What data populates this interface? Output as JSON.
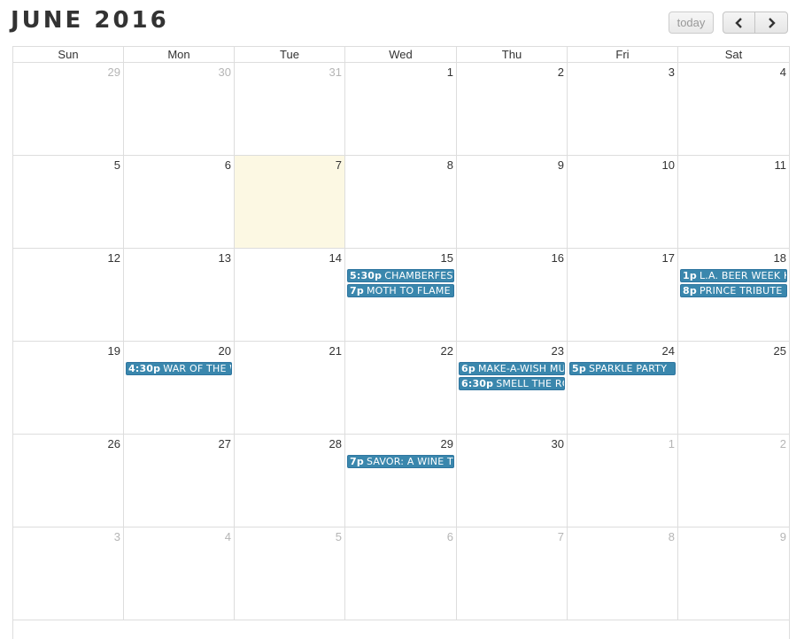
{
  "header": {
    "title": "JUNE 2016",
    "today_label": "today",
    "prev_icon": "chevron-left-icon",
    "next_icon": "chevron-right-icon"
  },
  "weekdays": [
    "Sun",
    "Mon",
    "Tue",
    "Wed",
    "Thu",
    "Fri",
    "Sat"
  ],
  "weeks": [
    {
      "days": [
        {
          "num": "29",
          "other": true
        },
        {
          "num": "30",
          "other": true
        },
        {
          "num": "31",
          "other": true
        },
        {
          "num": "1"
        },
        {
          "num": "2"
        },
        {
          "num": "3"
        },
        {
          "num": "4"
        }
      ]
    },
    {
      "days": [
        {
          "num": "5"
        },
        {
          "num": "6"
        },
        {
          "num": "7",
          "today": true
        },
        {
          "num": "8"
        },
        {
          "num": "9"
        },
        {
          "num": "10"
        },
        {
          "num": "11"
        }
      ]
    },
    {
      "days": [
        {
          "num": "12"
        },
        {
          "num": "13"
        },
        {
          "num": "14"
        },
        {
          "num": "15",
          "events": [
            {
              "time": "5:30p",
              "title": "CHAMBERFEST"
            },
            {
              "time": "7p",
              "title": "MOTH TO FLAME"
            }
          ]
        },
        {
          "num": "16"
        },
        {
          "num": "17"
        },
        {
          "num": "18",
          "events": [
            {
              "time": "1p",
              "title": "L.A. BEER WEEK K"
            },
            {
              "time": "8p",
              "title": "PRINCE TRIBUTE"
            }
          ]
        }
      ]
    },
    {
      "days": [
        {
          "num": "19"
        },
        {
          "num": "20",
          "events": [
            {
              "time": "4:30p",
              "title": "WAR OF THE W"
            }
          ]
        },
        {
          "num": "21"
        },
        {
          "num": "22"
        },
        {
          "num": "23",
          "events": [
            {
              "time": "6p",
              "title": "MAKE-A-WISH MU"
            },
            {
              "time": "6:30p",
              "title": "SMELL THE RO"
            }
          ]
        },
        {
          "num": "24",
          "events": [
            {
              "time": "5p",
              "title": "SPARKLE PARTY"
            }
          ]
        },
        {
          "num": "25"
        }
      ]
    },
    {
      "days": [
        {
          "num": "26"
        },
        {
          "num": "27"
        },
        {
          "num": "28"
        },
        {
          "num": "29",
          "events": [
            {
              "time": "7p",
              "title": "SAVOR: A WINE T"
            }
          ]
        },
        {
          "num": "30"
        },
        {
          "num": "1",
          "other": true
        },
        {
          "num": "2",
          "other": true
        }
      ]
    },
    {
      "days": [
        {
          "num": "3",
          "other": true
        },
        {
          "num": "4",
          "other": true
        },
        {
          "num": "5",
          "other": true
        },
        {
          "num": "6",
          "other": true
        },
        {
          "num": "7",
          "other": true
        },
        {
          "num": "8",
          "other": true
        },
        {
          "num": "9",
          "other": true
        }
      ]
    }
  ],
  "colors": {
    "event_bg": "#3a87ad",
    "today_bg": "#fcf8e3"
  }
}
